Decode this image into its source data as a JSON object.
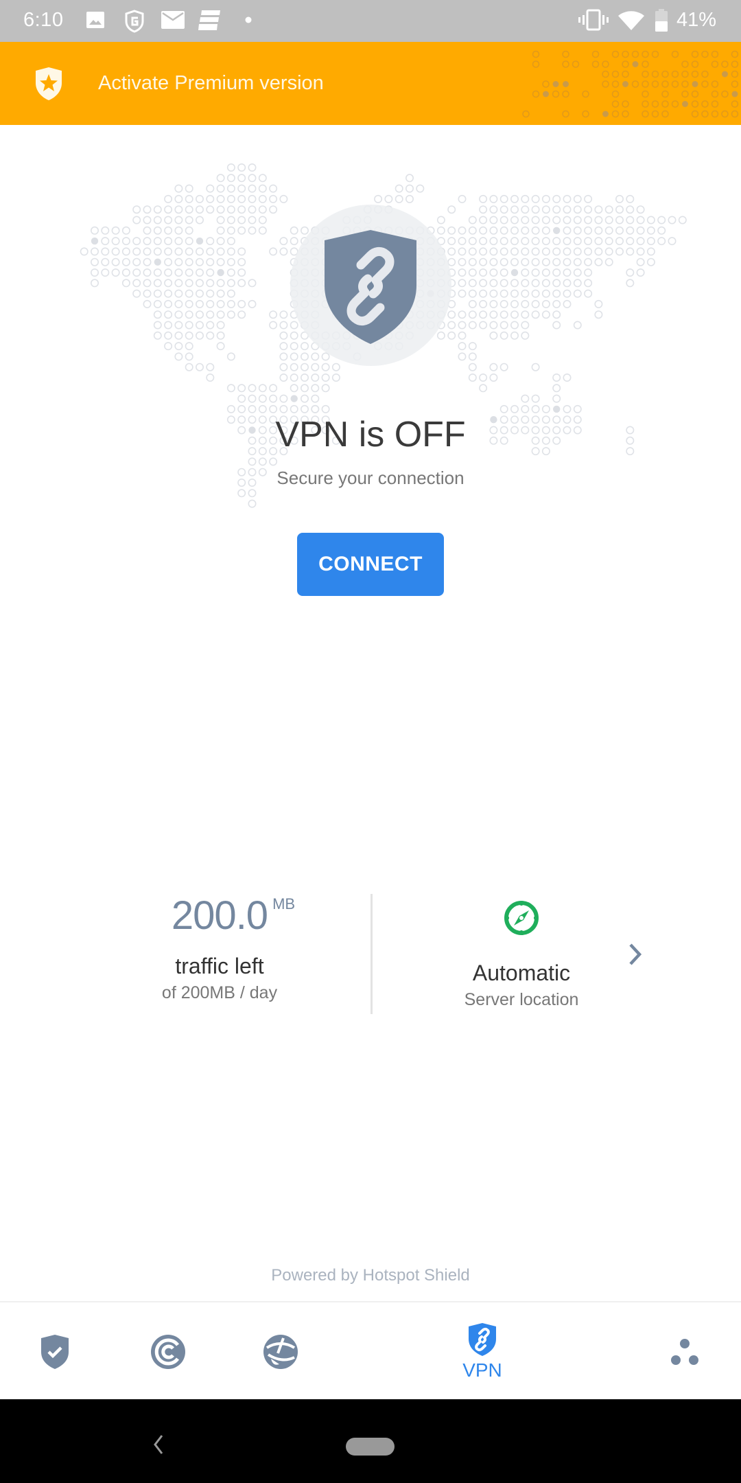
{
  "status_bar": {
    "time": "6:10",
    "notification_icons": [
      "image-icon",
      "g-shield-icon",
      "mail-icon",
      "news-icon",
      "dot-icon"
    ],
    "system_icons": [
      "vibrate-icon",
      "wifi-icon",
      "battery-icon"
    ],
    "battery": "41%"
  },
  "banner": {
    "label": "Activate Premium version",
    "icon": "star-shield-icon",
    "background_color": "#ffaa00"
  },
  "vpn": {
    "status_title": "VPN is OFF",
    "status_subtitle": "Secure your connection",
    "connect_label": "CONNECT",
    "accent_color": "#2f86eb",
    "shield_color": "#74879f"
  },
  "traffic": {
    "value": "200.0",
    "unit": "MB",
    "label": "traffic left",
    "sub": "of 200MB / day"
  },
  "server": {
    "icon": "compass-icon",
    "icon_color": "#1fae5b",
    "label": "Automatic",
    "sub": "Server location"
  },
  "footer": {
    "powered_by": "Powered by Hotspot Shield"
  },
  "bottom_nav": {
    "items": [
      {
        "id": "protection",
        "icon": "shield-check-icon",
        "label": "",
        "active": false
      },
      {
        "id": "privacy",
        "icon": "privacy-icon",
        "label": "",
        "active": false
      },
      {
        "id": "performance",
        "icon": "performance-icon",
        "label": "",
        "active": false
      },
      {
        "id": "vpn",
        "icon": "vpn-shield-icon",
        "label": "VPN",
        "active": true
      },
      {
        "id": "more",
        "icon": "more-dots-icon",
        "label": "",
        "active": false
      }
    ]
  }
}
